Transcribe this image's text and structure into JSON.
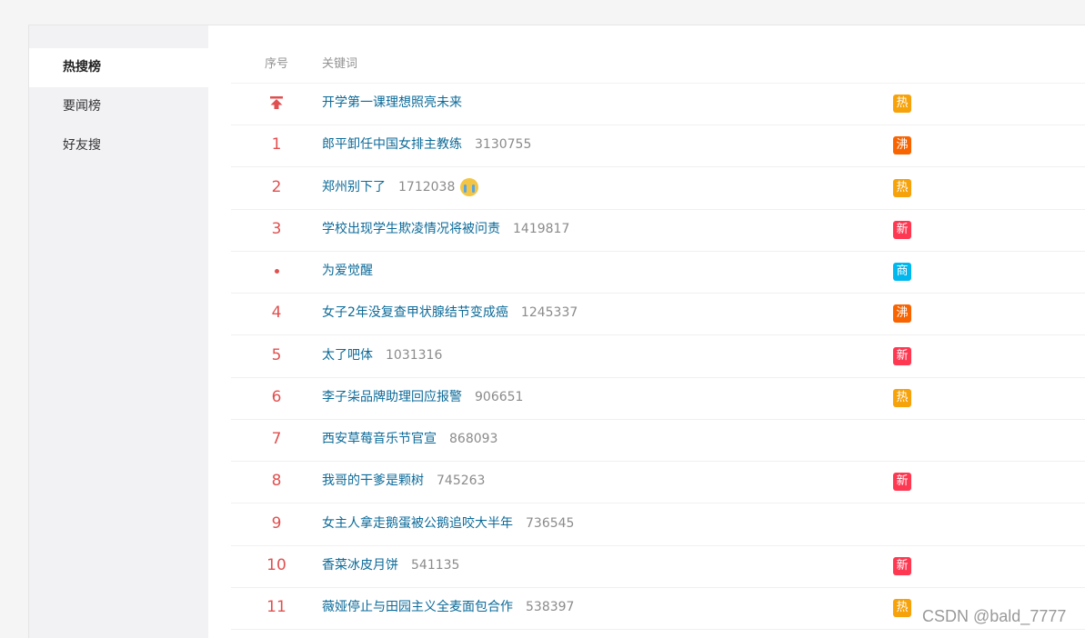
{
  "sidebar": {
    "items": [
      {
        "label": "热搜榜",
        "active": true
      },
      {
        "label": "要闻榜",
        "active": false
      },
      {
        "label": "好友搜",
        "active": false
      }
    ]
  },
  "table": {
    "headers": {
      "rank": "序号",
      "keyword": "关键词"
    },
    "rows": [
      {
        "rank": "",
        "rank_type": "pinned",
        "keyword": "开学第一课理想照亮未来",
        "count": "",
        "badge": "热",
        "badge_color": "#f6a20a"
      },
      {
        "rank": "1",
        "rank_type": "number",
        "keyword": "郎平卸任中国女排主教练",
        "count": "3130755",
        "badge": "沸",
        "badge_color": "#f86400"
      },
      {
        "rank": "2",
        "rank_type": "number",
        "keyword": "郑州别下了",
        "count": "1712038",
        "emoji": "crying-face-icon",
        "badge": "热",
        "badge_color": "#f6a20a"
      },
      {
        "rank": "3",
        "rank_type": "number",
        "keyword": "学校出现学生欺凌情况将被问责",
        "count": "1419817",
        "badge": "新",
        "badge_color": "#ff3852"
      },
      {
        "rank": "",
        "rank_type": "dot",
        "keyword": "为爱觉醒",
        "count": "",
        "badge": "商",
        "badge_color": "#00b7ee"
      },
      {
        "rank": "4",
        "rank_type": "number",
        "keyword": "女子2年没复查甲状腺结节变成癌",
        "count": "1245337",
        "badge": "沸",
        "badge_color": "#f86400"
      },
      {
        "rank": "5",
        "rank_type": "number",
        "keyword": "太了吧体",
        "count": "1031316",
        "badge": "新",
        "badge_color": "#ff3852"
      },
      {
        "rank": "6",
        "rank_type": "number",
        "keyword": "李子柒品牌助理回应报警",
        "count": "906651",
        "badge": "热",
        "badge_color": "#f6a20a"
      },
      {
        "rank": "7",
        "rank_type": "number",
        "keyword": "西安草莓音乐节官宣",
        "count": "868093",
        "badge": "",
        "badge_color": ""
      },
      {
        "rank": "8",
        "rank_type": "number",
        "keyword": "我哥的干爹是颗树",
        "count": "745263",
        "badge": "新",
        "badge_color": "#ff3852"
      },
      {
        "rank": "9",
        "rank_type": "number",
        "keyword": "女主人拿走鹅蛋被公鹅追咬大半年",
        "count": "736545",
        "badge": "",
        "badge_color": ""
      },
      {
        "rank": "10",
        "rank_type": "number",
        "keyword": "香菜冰皮月饼",
        "count": "541135",
        "badge": "新",
        "badge_color": "#ff3852"
      },
      {
        "rank": "11",
        "rank_type": "number",
        "keyword": "薇娅停止与田园主义全麦面包合作",
        "count": "538397",
        "badge": "热",
        "badge_color": "#f6a20a"
      }
    ]
  },
  "watermark": "CSDN @bald_7777"
}
